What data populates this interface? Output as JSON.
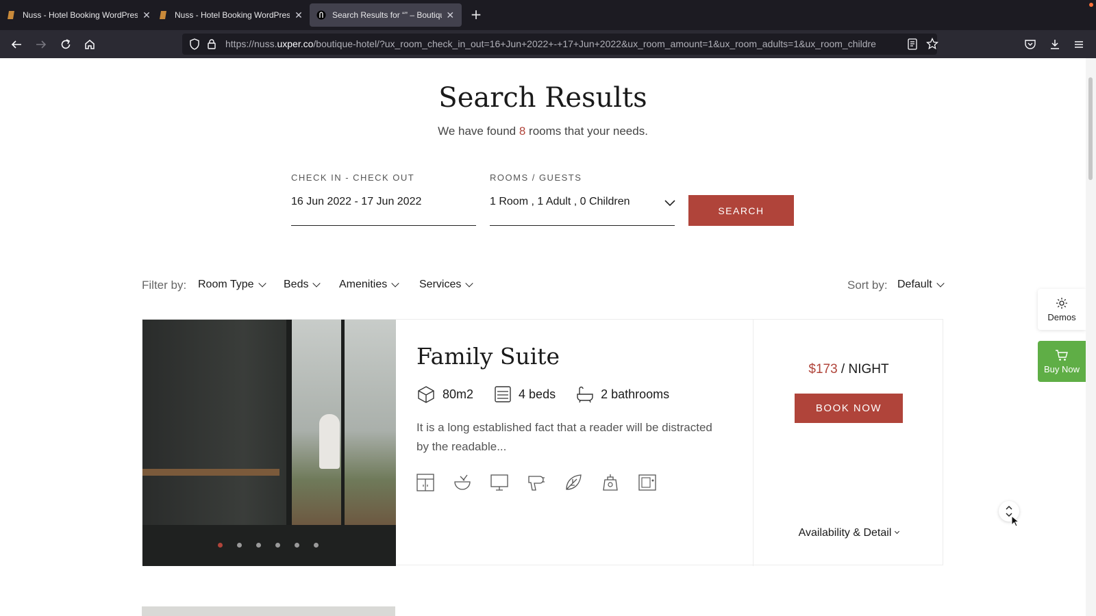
{
  "browser": {
    "tabs": [
      {
        "title": "Nuss - Hotel Booking WordPress",
        "active": false
      },
      {
        "title": "Nuss - Hotel Booking WordPress",
        "active": false
      },
      {
        "title": "Search Results for “” – Boutique",
        "active": true
      }
    ],
    "url_prefix": "https://nuss.",
    "url_domain": "uxper.co",
    "url_path": "/boutique-hotel/?ux_room_check_in_out=16+Jun+2022+-+17+Jun+2022&ux_room_amount=1&ux_room_adults=1&ux_room_childre"
  },
  "page": {
    "title": "Search Results",
    "subtitle_pre": "We have found ",
    "subtitle_count": "8",
    "subtitle_post": " rooms that your needs."
  },
  "search": {
    "checkin_label": "CHECK IN - CHECK OUT",
    "checkin_value": "16 Jun 2022 - 17 Jun 2022",
    "rooms_label": "ROOMS / GUESTS",
    "rooms_value": "1 Room , 1 Adult , 0 Children",
    "button": "SEARCH"
  },
  "filters": {
    "label": "Filter by:",
    "items": [
      "Room Type",
      "Beds",
      "Amenities",
      "Services"
    ],
    "sort_label": "Sort by:",
    "sort_value": "Default"
  },
  "room": {
    "name": "Family Suite",
    "area": "80m2",
    "beds": "4 beds",
    "bathrooms": "2 bathrooms",
    "description": "It is a long established fact that a reader will be distracted by the readable...",
    "price": "$173",
    "price_unit": " / NIGHT",
    "book_button": "BOOK NOW",
    "details_link": "Availability & Detail",
    "amenity_icons": [
      "wardrobe-icon",
      "food-bowl-icon",
      "tv-icon",
      "hair-dryer-icon",
      "leaf-icon",
      "kettle-icon",
      "safe-icon"
    ]
  },
  "side": {
    "demos": "Demos",
    "buy_now": "Buy Now"
  },
  "colors": {
    "accent": "#b0443a",
    "buy_green": "#5fae46"
  }
}
